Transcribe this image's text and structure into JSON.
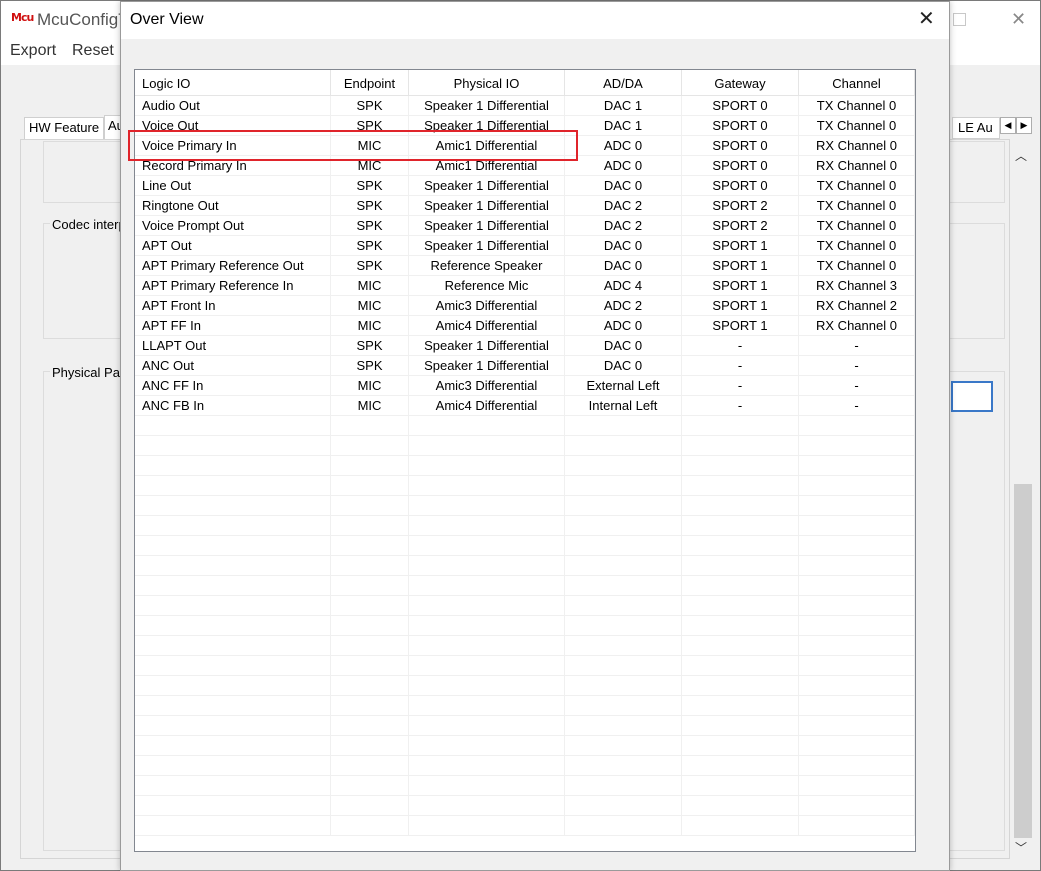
{
  "main_window": {
    "logo": "Mcu",
    "title": "McuConfigT",
    "menu": [
      "Export",
      "Reset"
    ],
    "tabs": {
      "hw_feature": "HW Feature",
      "audio": "Au",
      "le_audio": "LE Au"
    },
    "groups": [
      "Codec interp",
      "Physical Path"
    ],
    "icons": {
      "maximize": "maximize-icon",
      "close": "close-icon",
      "tab_left": "triangle-left-icon",
      "tab_right": "triangle-right-icon",
      "scroll_up": "chevron-up-icon",
      "scroll_down": "chevron-down-icon"
    }
  },
  "dialog": {
    "title": "Over View",
    "close_glyph": "✕",
    "columns": [
      "Logic IO",
      "Endpoint",
      "Physical IO",
      "AD/DA",
      "Gateway",
      "Channel"
    ],
    "rows": [
      [
        "Audio Out",
        "SPK",
        "Speaker 1 Differential",
        "DAC 1",
        "SPORT 0",
        "TX Channel 0"
      ],
      [
        "Voice Out",
        "SPK",
        "Speaker 1 Differential",
        "DAC 1",
        "SPORT 0",
        "TX Channel 0"
      ],
      [
        "Voice Primary In",
        "MIC",
        "Amic1 Differential",
        "ADC 0",
        "SPORT 0",
        "RX Channel 0"
      ],
      [
        "Record Primary In",
        "MIC",
        "Amic1 Differential",
        "ADC 0",
        "SPORT 0",
        "RX Channel 0"
      ],
      [
        "Line Out",
        "SPK",
        "Speaker 1 Differential",
        "DAC 0",
        "SPORT 0",
        "TX Channel 0"
      ],
      [
        "Ringtone Out",
        "SPK",
        "Speaker 1 Differential",
        "DAC 2",
        "SPORT 2",
        "TX Channel 0"
      ],
      [
        "Voice Prompt Out",
        "SPK",
        "Speaker 1 Differential",
        "DAC 2",
        "SPORT 2",
        "TX Channel 0"
      ],
      [
        "APT Out",
        "SPK",
        "Speaker 1 Differential",
        "DAC 0",
        "SPORT 1",
        "TX Channel 0"
      ],
      [
        "APT Primary Reference Out",
        "SPK",
        "Reference Speaker",
        "DAC 0",
        "SPORT 1",
        "TX Channel 0"
      ],
      [
        "APT Primary Reference In",
        "MIC",
        "Reference Mic",
        "ADC 4",
        "SPORT 1",
        "RX Channel 3"
      ],
      [
        "APT Front In",
        "MIC",
        "Amic3 Differential",
        "ADC 2",
        "SPORT 1",
        "RX Channel 2"
      ],
      [
        "APT FF In",
        "MIC",
        "Amic4 Differential",
        "ADC 0",
        "SPORT 1",
        "RX Channel 0"
      ],
      [
        "LLAPT Out",
        "SPK",
        "Speaker 1 Differential",
        "DAC 0",
        "-",
        "-"
      ],
      [
        "ANC Out",
        "SPK",
        "Speaker 1 Differential",
        "DAC 0",
        "-",
        "-"
      ],
      [
        "ANC FF In",
        "MIC",
        "Amic3 Differential",
        "External Left",
        "-",
        "-"
      ],
      [
        "ANC FB In",
        "MIC",
        "Amic4 Differential",
        "Internal Left",
        "-",
        "-"
      ]
    ],
    "highlight_color": "#e0242b"
  }
}
